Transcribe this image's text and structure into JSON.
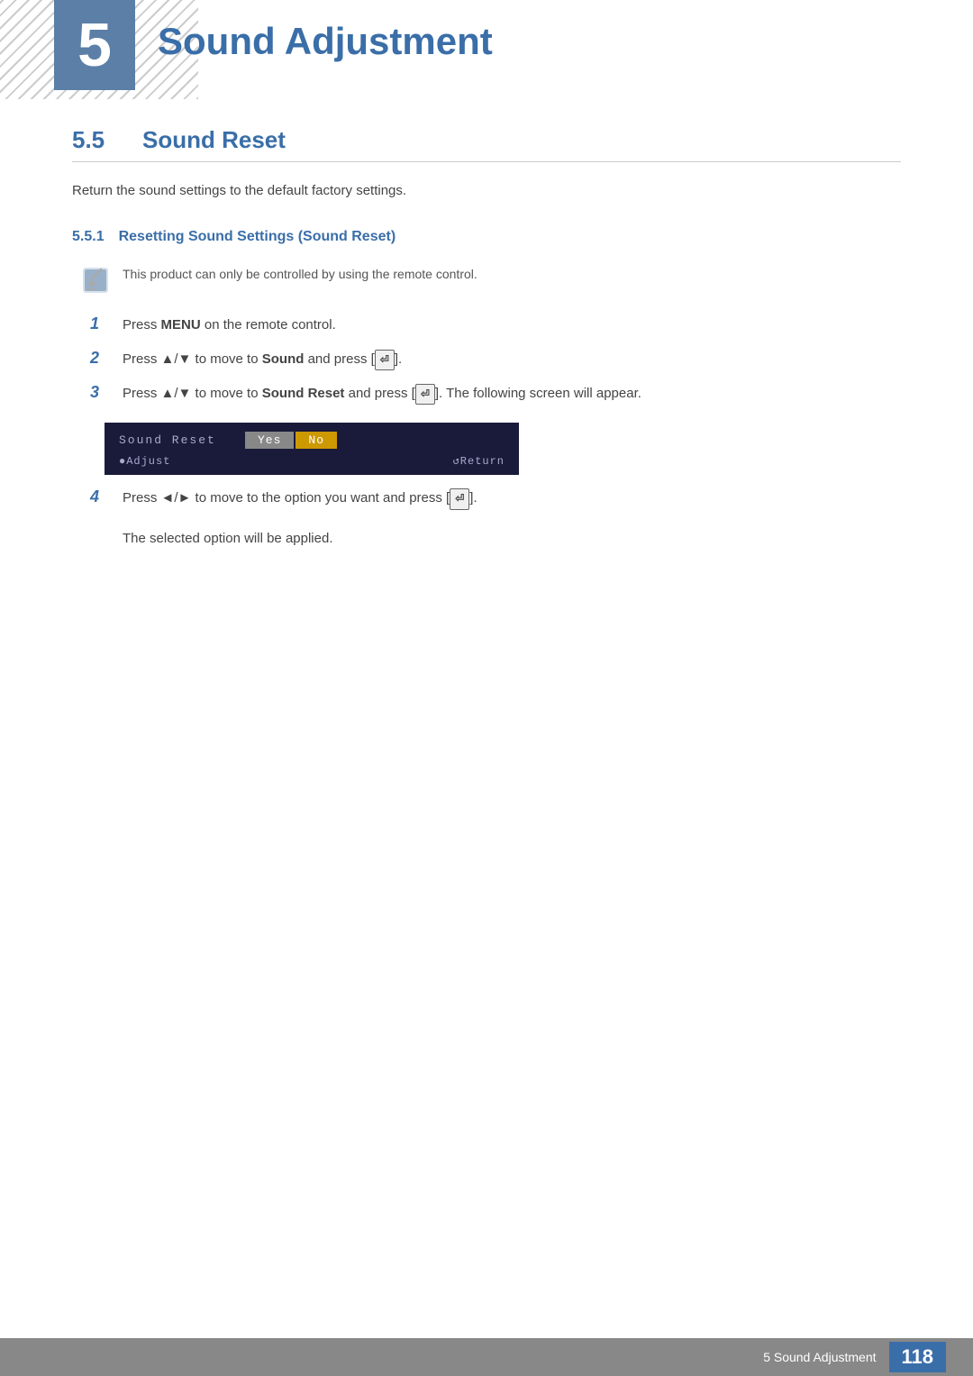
{
  "header": {
    "chapter_number": "5",
    "chapter_title": "Sound Adjustment"
  },
  "section": {
    "number": "5.5",
    "title": "Sound Reset",
    "description": "Return the sound settings to the default factory settings."
  },
  "subsection": {
    "number": "5.5.1",
    "title": "Resetting Sound Settings (Sound Reset)"
  },
  "note": {
    "text": "This product can only be controlled by using the remote control."
  },
  "steps": [
    {
      "number": "1",
      "text": "Press MENU on the remote control."
    },
    {
      "number": "2",
      "text": "Press ▲/▼ to move to Sound and press [⏎]."
    },
    {
      "number": "3",
      "text": "Press ▲/▼ to move to Sound Reset and press [⏎]. The following screen will appear."
    },
    {
      "number": "4",
      "text": "Press ◄/► to move to the option you want and press [⏎]."
    }
  ],
  "screen": {
    "label": "Sound Reset",
    "yes_label": "Yes",
    "no_label": "No",
    "adjust_label": "●Adjust",
    "return_label": "↺Return"
  },
  "step4_continuation": "The selected option will be applied.",
  "footer": {
    "text": "5 Sound Adjustment",
    "page_number": "118"
  }
}
